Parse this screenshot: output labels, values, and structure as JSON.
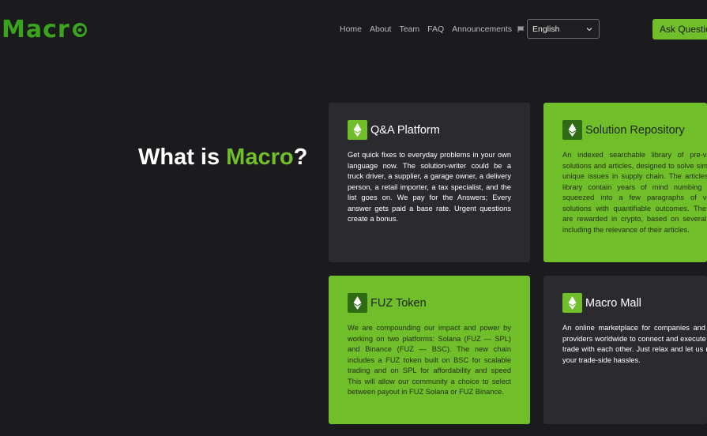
{
  "brand": {
    "name": "Macr",
    "logo_colors": [
      "#3aa51c",
      "#1b1b1e"
    ]
  },
  "nav": {
    "links": [
      "Home",
      "About",
      "Team",
      "FAQ",
      "Announcements"
    ],
    "language_icon": "language-flag-icon",
    "language_selected": "English",
    "cta_label": "Ask Questions"
  },
  "hero": {
    "prefix": "What is ",
    "accent": "Macro",
    "suffix": "?"
  },
  "colors": {
    "background": "#1b1b1e",
    "card_dark": "#2b2b2f",
    "accent_green": "#6fbe2a"
  },
  "cards": [
    {
      "title": "Q&A Platform",
      "icon": "ethereum-diamond-icon",
      "style": "dark",
      "text": "Get quick fixes to everyday problems in your own language now. The solution-writer could be a truck driver, a supplier, a garage owner, a delivery person, a retail importer, a tax specialist, and the list goes on. We pay for the Answers; Every answer gets paid a base rate. Urgent questions create a bonus."
    },
    {
      "title": "Solution Repository",
      "icon": "ethereum-diamond-icon",
      "style": "green",
      "text": "An indexed searchable library of pre-validated solutions and articles, designed to solve similar and unique issues in supply chain. The articles in this library contain years of mind numbing wisdom squeezed into a few paragraphs of validated solutions with quantifiable outcomes. The writers are rewarded in crypto, based on several factors including the relevance of their articles."
    },
    {
      "title": "FUZ Token",
      "icon": "ethereum-diamond-icon",
      "style": "green",
      "text": "We are compounding our impact and power by working on two platforms: Solana (FUZ — SPL) and Binance (FUZ — BSC). The new chain includes a FUZ token built on BSC for scalable trading and on SPL for affordability and speed This will allow our community a choice to select between payout in FUZ Solana or FUZ Binance."
    },
    {
      "title": "Macro Mall",
      "icon": "ethereum-diamond-icon",
      "style": "dark",
      "text": "An online marketplace for companies and service providers worldwide to connect and execute smooth trade with each other. Just relax and let us manage your trade-side hassles."
    }
  ]
}
